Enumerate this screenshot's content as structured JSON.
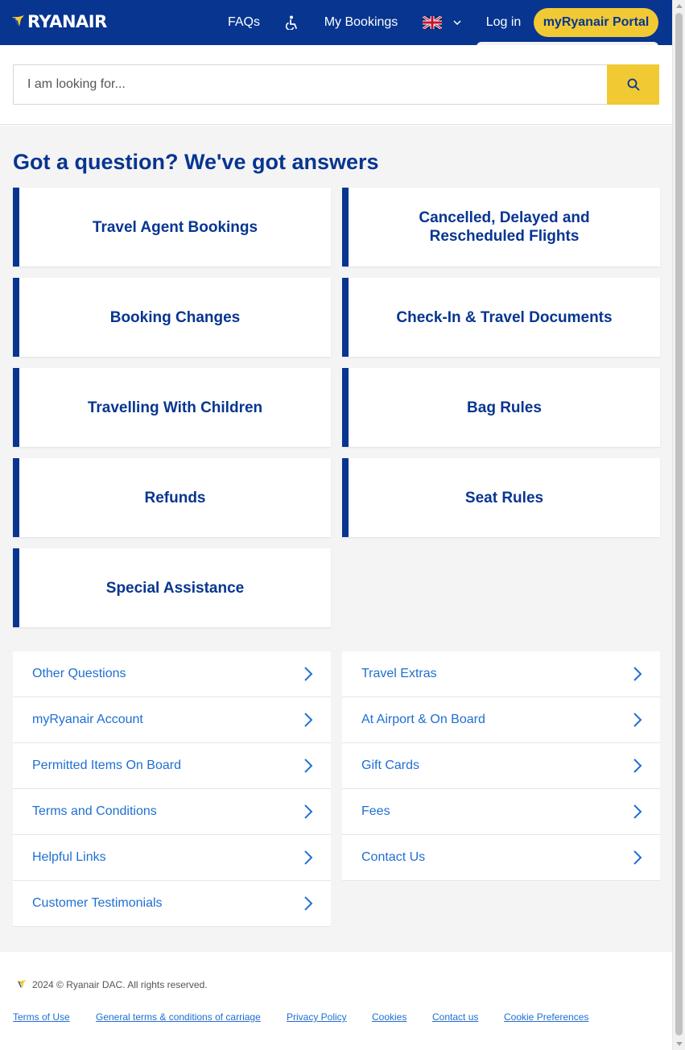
{
  "header": {
    "logo_text": "RYANAIR",
    "nav": {
      "faqs": "FAQs",
      "my_bookings": "My Bookings",
      "log_in": "Log in",
      "portal": "myRyanair Portal"
    },
    "language_flag": "uk-flag-icon",
    "accessibility_icon": "wheelchair-icon"
  },
  "search": {
    "placeholder": "I am looking for...",
    "button_icon": "search-icon"
  },
  "main": {
    "headline": "Got a question? We've got answers",
    "cards": [
      "Travel Agent Bookings",
      "Cancelled, Delayed and Rescheduled Flights",
      "Booking Changes",
      "Check-In & Travel Documents",
      "Travelling With Children",
      "Bag Rules",
      "Refunds",
      "Seat Rules",
      "Special Assistance"
    ],
    "links_left": [
      "Other Questions",
      "myRyanair Account",
      "Permitted Items On Board",
      "Terms and Conditions",
      "Helpful Links",
      "Customer Testimonials"
    ],
    "links_right": [
      "Travel Extras",
      "At Airport & On Board",
      "Gift Cards",
      "Fees",
      "Contact Us"
    ]
  },
  "footer": {
    "copyright": "2024 © Ryanair DAC. All rights reserved.",
    "links": [
      "Terms of Use",
      "General terms & conditions of carriage",
      "Privacy Policy",
      "Cookies",
      "Contact us",
      "Cookie Preferences"
    ]
  },
  "colors": {
    "brand_blue": "#073590",
    "brand_yellow": "#f1c933",
    "link_blue": "#1f6fd1"
  }
}
